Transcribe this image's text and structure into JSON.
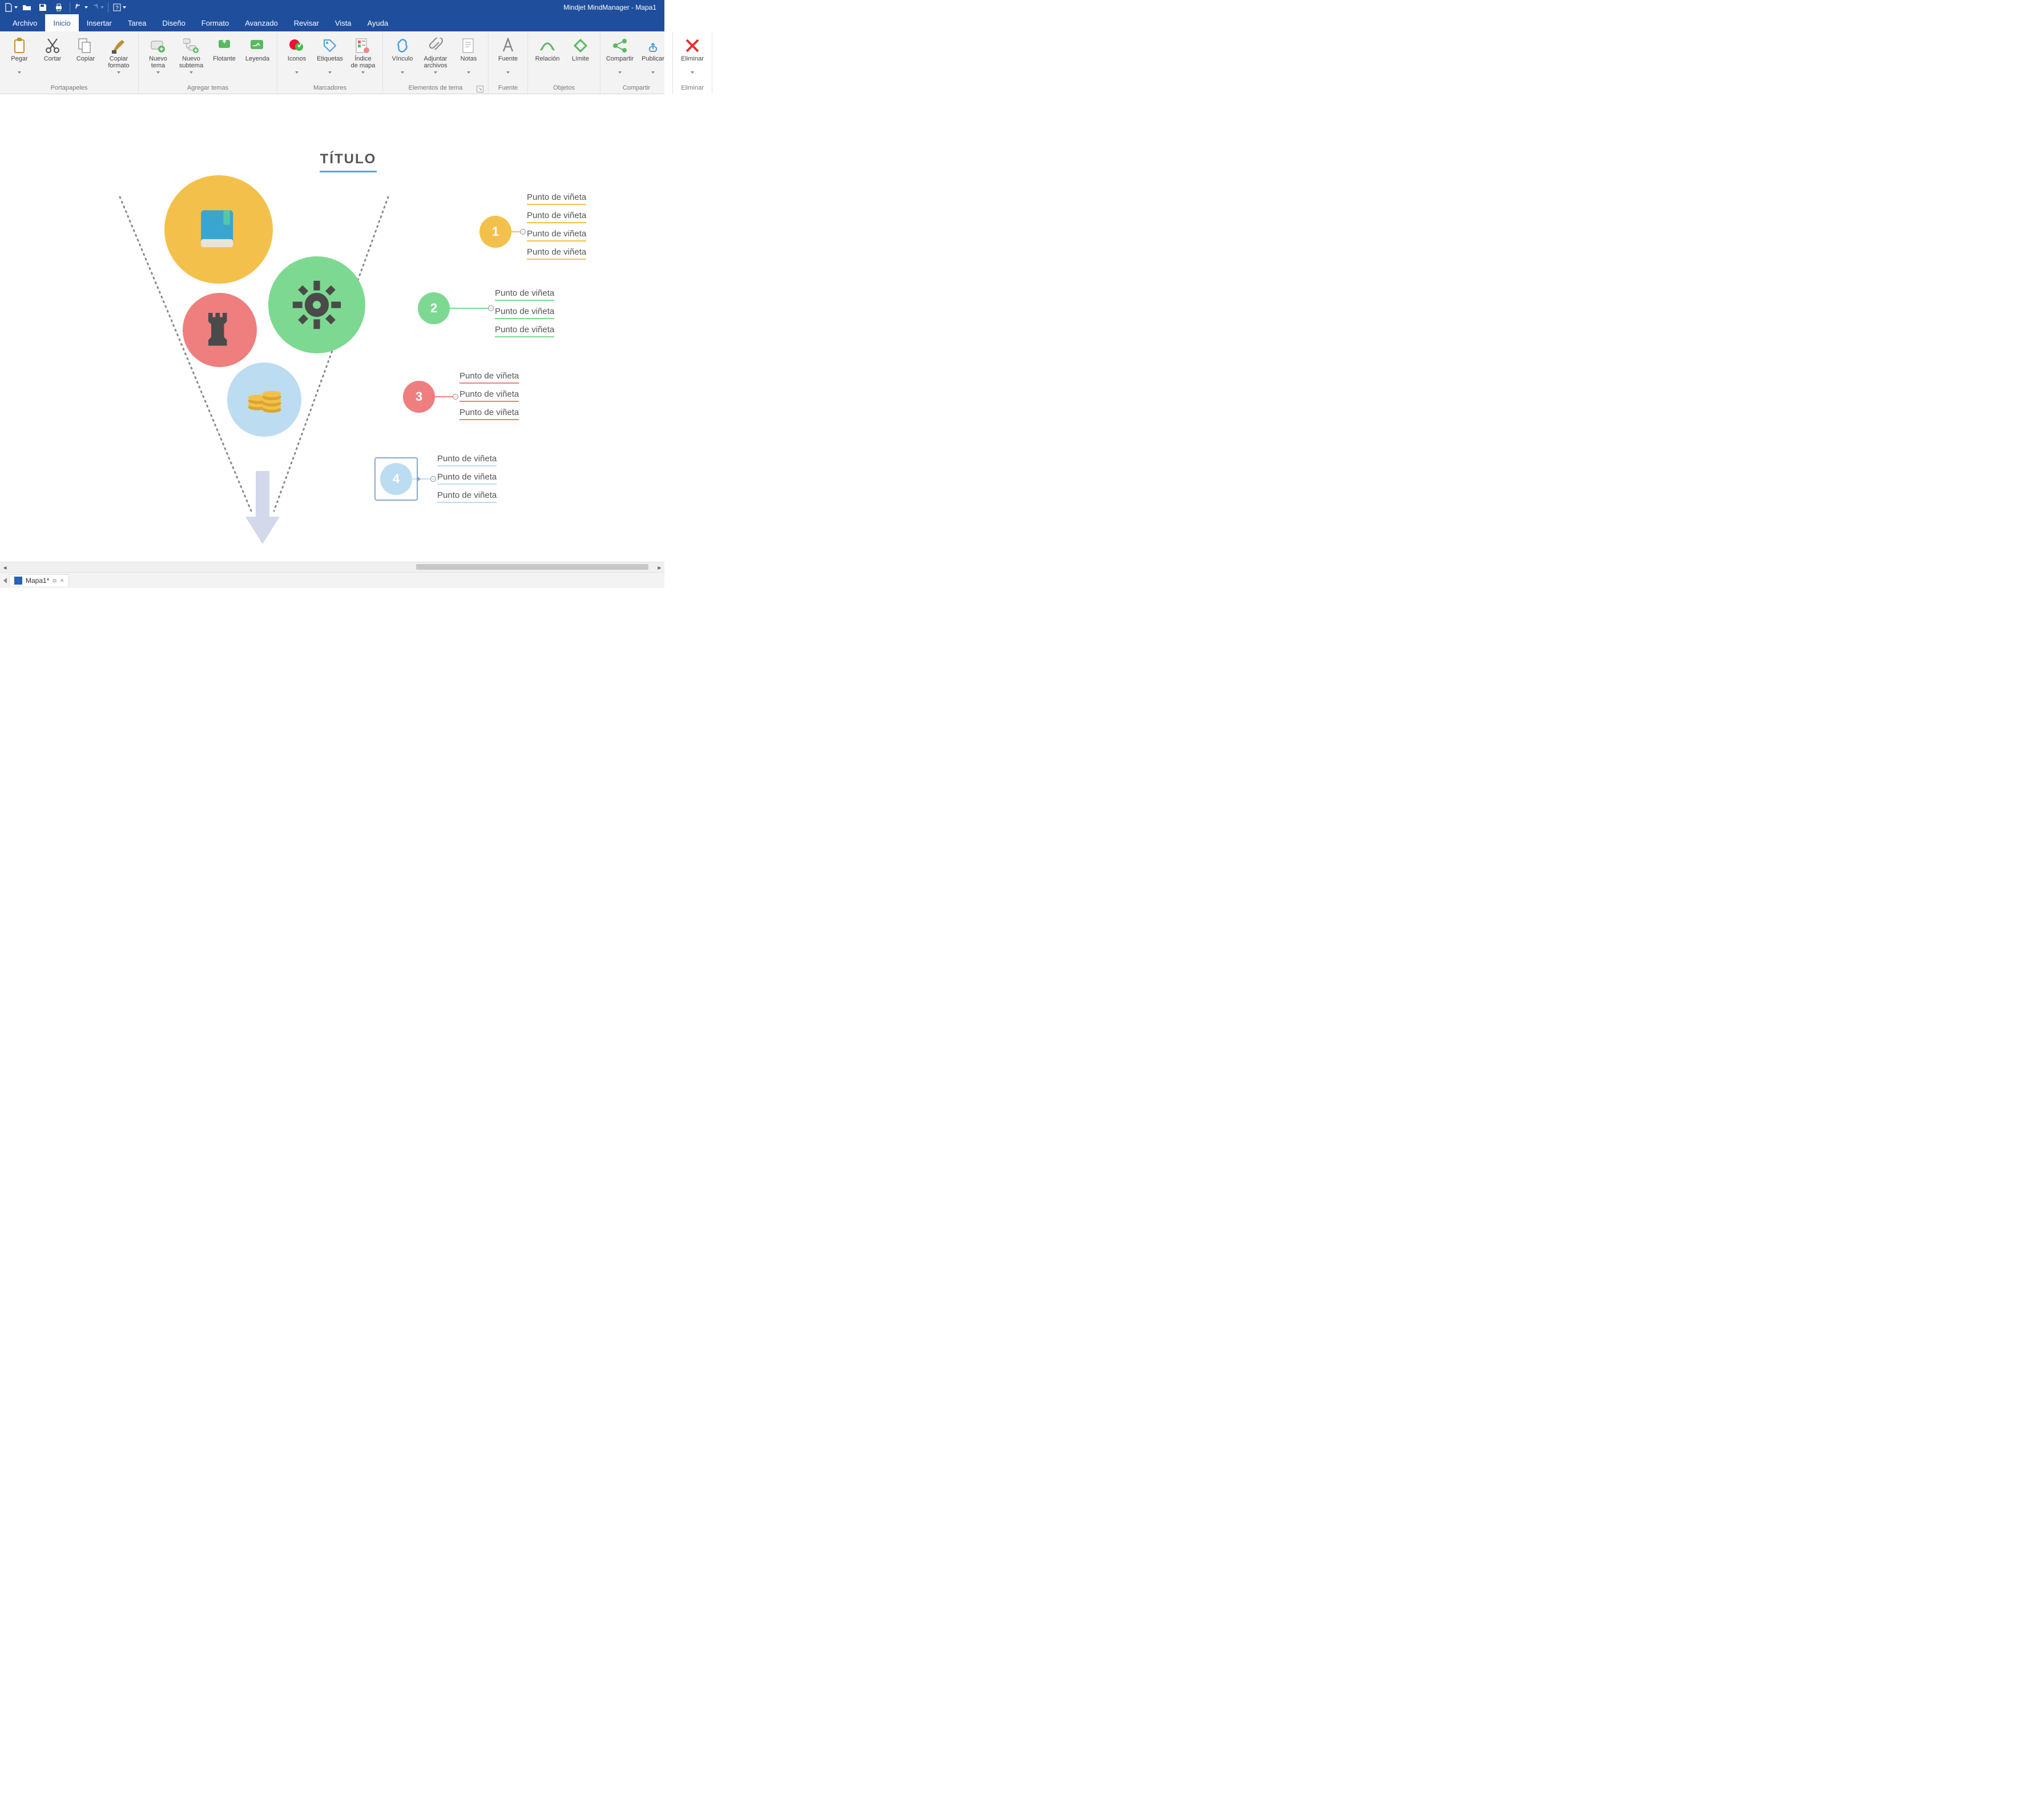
{
  "app_title": "Mindjet MindManager - Mapa1",
  "menubar": [
    "Archivo",
    "Inicio",
    "Insertar",
    "Tarea",
    "Diseño",
    "Formato",
    "Avanzado",
    "Revisar",
    "Vista",
    "Ayuda"
  ],
  "active_menu_index": 1,
  "ribbon_groups": [
    {
      "label": "Portapapeles",
      "items": [
        {
          "label": "Pegar",
          "caret": true,
          "icon": "paste"
        },
        {
          "label": "Cortar",
          "icon": "cut"
        },
        {
          "label": "Copiar",
          "icon": "copy"
        },
        {
          "label": "Copiar formato",
          "caret": true,
          "icon": "brush"
        }
      ]
    },
    {
      "label": "Agregar temas",
      "items": [
        {
          "label": "Nuevo tema",
          "caret": true,
          "icon": "newtopic"
        },
        {
          "label": "Nuevo subtema",
          "caret": true,
          "icon": "newsub"
        },
        {
          "label": "Flotante",
          "icon": "float"
        },
        {
          "label": "Leyenda",
          "icon": "legend"
        }
      ]
    },
    {
      "label": "Marcadores",
      "items": [
        {
          "label": "Iconos",
          "caret": true,
          "icon": "icons"
        },
        {
          "label": "Etiquetas",
          "caret": true,
          "icon": "tag"
        },
        {
          "label": "Índice de mapa",
          "caret": true,
          "icon": "index"
        }
      ]
    },
    {
      "label": "Elementos de tema",
      "launcher": true,
      "items": [
        {
          "label": "Vínculo",
          "caret": true,
          "icon": "link"
        },
        {
          "label": "Adjuntar archivos",
          "caret": true,
          "icon": "attach"
        },
        {
          "label": "Notas",
          "caret": true,
          "icon": "notes"
        }
      ]
    },
    {
      "label": "Fuente",
      "items": [
        {
          "label": "Fuente",
          "caret": true,
          "icon": "font"
        }
      ]
    },
    {
      "label": "Objetos",
      "items": [
        {
          "label": "Relación",
          "icon": "relation"
        },
        {
          "label": "Límite",
          "icon": "limit"
        }
      ]
    },
    {
      "label": "Compartir",
      "items": [
        {
          "label": "Compartir",
          "caret": true,
          "icon": "share"
        },
        {
          "label": "Publicar",
          "caret": true,
          "icon": "publish"
        }
      ]
    },
    {
      "label": "Eliminar",
      "items": [
        {
          "label": "Eliminar",
          "caret": true,
          "icon": "delete"
        }
      ]
    }
  ],
  "canvas": {
    "title": "TÍTULO",
    "nodes": [
      {
        "num": "1",
        "color": "yellow",
        "bullets": [
          "Punto de viñeta",
          "Punto de viñeta",
          "Punto de viñeta",
          "Punto de viñeta"
        ]
      },
      {
        "num": "2",
        "color": "green",
        "bullets": [
          "Punto de viñeta",
          "Punto de viñeta",
          "Punto de viñeta"
        ]
      },
      {
        "num": "3",
        "color": "red",
        "bullets": [
          "Punto de viñeta",
          "Punto de viñeta",
          "Punto de viñeta"
        ]
      },
      {
        "num": "4",
        "color": "blue",
        "bullets": [
          "Punto de viñeta",
          "Punto de viñeta",
          "Punto de viñeta"
        ],
        "selected": true
      }
    ]
  },
  "doc_tab": "Mapa1*",
  "colors": {
    "yellow": "#f3c14b",
    "green": "#7dd991",
    "red": "#ef7e7e",
    "blue": "#bcdcf2"
  }
}
